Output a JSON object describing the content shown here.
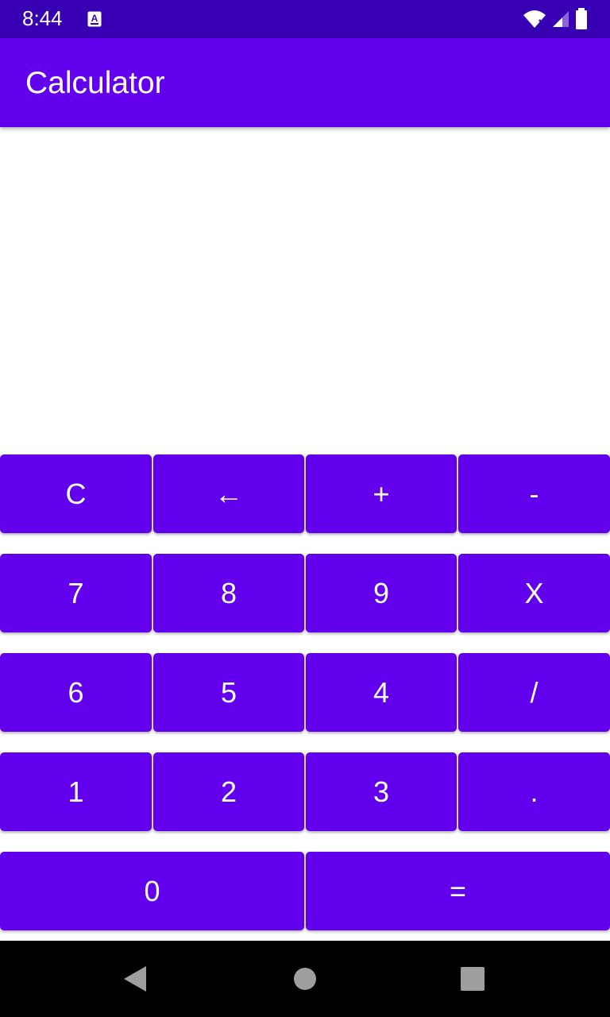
{
  "status_bar": {
    "time": "8:44",
    "app_icon": "a-notification-icon",
    "icons": [
      "wifi-icon",
      "signal-icon",
      "battery-icon"
    ]
  },
  "app_bar": {
    "title": "Calculator"
  },
  "display": {
    "expression": "",
    "result": ""
  },
  "keypad": {
    "rows": [
      [
        "C",
        "←",
        "+",
        "-"
      ],
      [
        "7",
        "8",
        "9",
        "X"
      ],
      [
        "6",
        "5",
        "4",
        "/"
      ],
      [
        "1",
        "2",
        "3",
        "."
      ],
      [
        "0",
        "="
      ]
    ]
  },
  "nav_bar": {
    "buttons": [
      "back-icon",
      "home-icon",
      "recents-icon"
    ]
  },
  "colors": {
    "status_bar": "#3700B3",
    "primary": "#6200EE",
    "text_on_primary": "#FFFFFF",
    "nav_bar": "#000000"
  }
}
